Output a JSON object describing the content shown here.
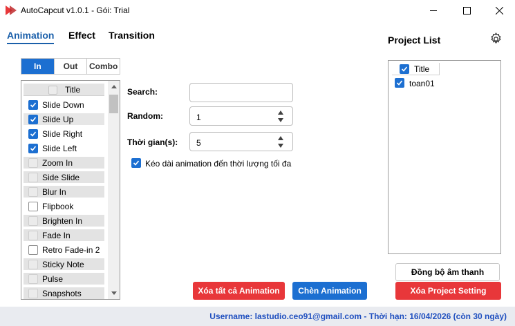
{
  "window": {
    "title": "AutoCapcut v1.0.1 - Gói: Trial",
    "controls": [
      "minimize-icon",
      "maximize-icon",
      "close-icon"
    ]
  },
  "main_tabs": [
    {
      "label": "Animation",
      "active": true
    },
    {
      "label": "Effect",
      "active": false
    },
    {
      "label": "Transition",
      "active": false
    }
  ],
  "sub_tabs": [
    {
      "label": "In",
      "active": true
    },
    {
      "label": "Out",
      "active": false
    },
    {
      "label": "Combo",
      "active": false
    }
  ],
  "animation_list": {
    "header": "Title",
    "items": [
      {
        "label": "Slide Down",
        "checked": true,
        "style": "normal"
      },
      {
        "label": "Slide Up",
        "checked": true,
        "style": "selected"
      },
      {
        "label": "Slide Right",
        "checked": true,
        "style": "normal"
      },
      {
        "label": "Slide Left",
        "checked": true,
        "style": "normal"
      },
      {
        "label": "Zoom In",
        "checked": false,
        "style": "gray"
      },
      {
        "label": "Side Slide",
        "checked": false,
        "style": "gray"
      },
      {
        "label": "Blur In",
        "checked": false,
        "style": "gray"
      },
      {
        "label": "Flipbook",
        "checked": false,
        "style": "normal"
      },
      {
        "label": "Brighten In",
        "checked": false,
        "style": "gray"
      },
      {
        "label": "Fade In",
        "checked": false,
        "style": "gray"
      },
      {
        "label": "Retro Fade-in 2",
        "checked": false,
        "style": "normal"
      },
      {
        "label": "Sticky Note",
        "checked": false,
        "style": "gray"
      },
      {
        "label": "Pulse",
        "checked": false,
        "style": "gray"
      },
      {
        "label": "Snapshots",
        "checked": false,
        "style": "gray"
      }
    ]
  },
  "form": {
    "search_label": "Search:",
    "search_value": "",
    "random_label": "Random:",
    "random_value": "1",
    "duration_label": "Thời gian(s):",
    "duration_value": "5",
    "extend_label": "Kéo dài animation đến thời lượng tối đa",
    "extend_checked": true
  },
  "buttons": {
    "clear_all": "Xóa tất cả Animation",
    "insert": "Chèn Animation",
    "sync_audio": "Đồng bộ âm thanh",
    "delete_project_setting": "Xóa Project Setting"
  },
  "project_list": {
    "title": "Project List",
    "header": "Title",
    "items": [
      {
        "label": "toan01",
        "checked": true
      }
    ]
  },
  "status": {
    "text": "Username: lastudio.ceo91@gmail.com - Thời hạn: 16/04/2026 (còn 30 ngày)"
  },
  "colors": {
    "accent_blue": "#1c6fd1",
    "tab_blue": "#1a5faa",
    "danger_red": "#e8373a",
    "status_text": "#1f4fbf",
    "status_bg": "#e9ebf0"
  }
}
